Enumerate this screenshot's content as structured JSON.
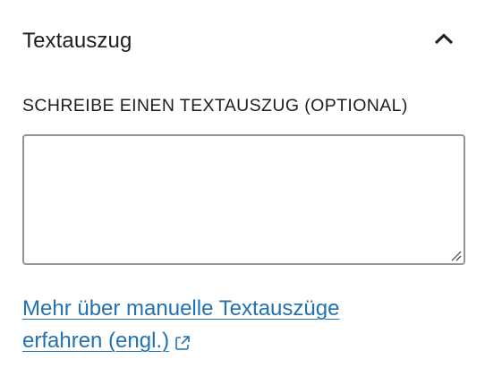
{
  "panel": {
    "title": "Textauszug",
    "toggle_icon": "chevron-up-icon",
    "expanded": true
  },
  "excerpt": {
    "label": "SCHREIBE EINEN TEXTAUSZUG (OPTIONAL)",
    "value": "",
    "placeholder": ""
  },
  "help_link": {
    "text_line1": "Mehr über manuelle Textauszüge",
    "text_line2": "erfahren (engl.)",
    "icon": "external-link-icon",
    "color": "#2271b1"
  },
  "colors": {
    "text": "#1e1e1e",
    "border": "#949494",
    "link": "#2271b1",
    "background": "#ffffff"
  }
}
